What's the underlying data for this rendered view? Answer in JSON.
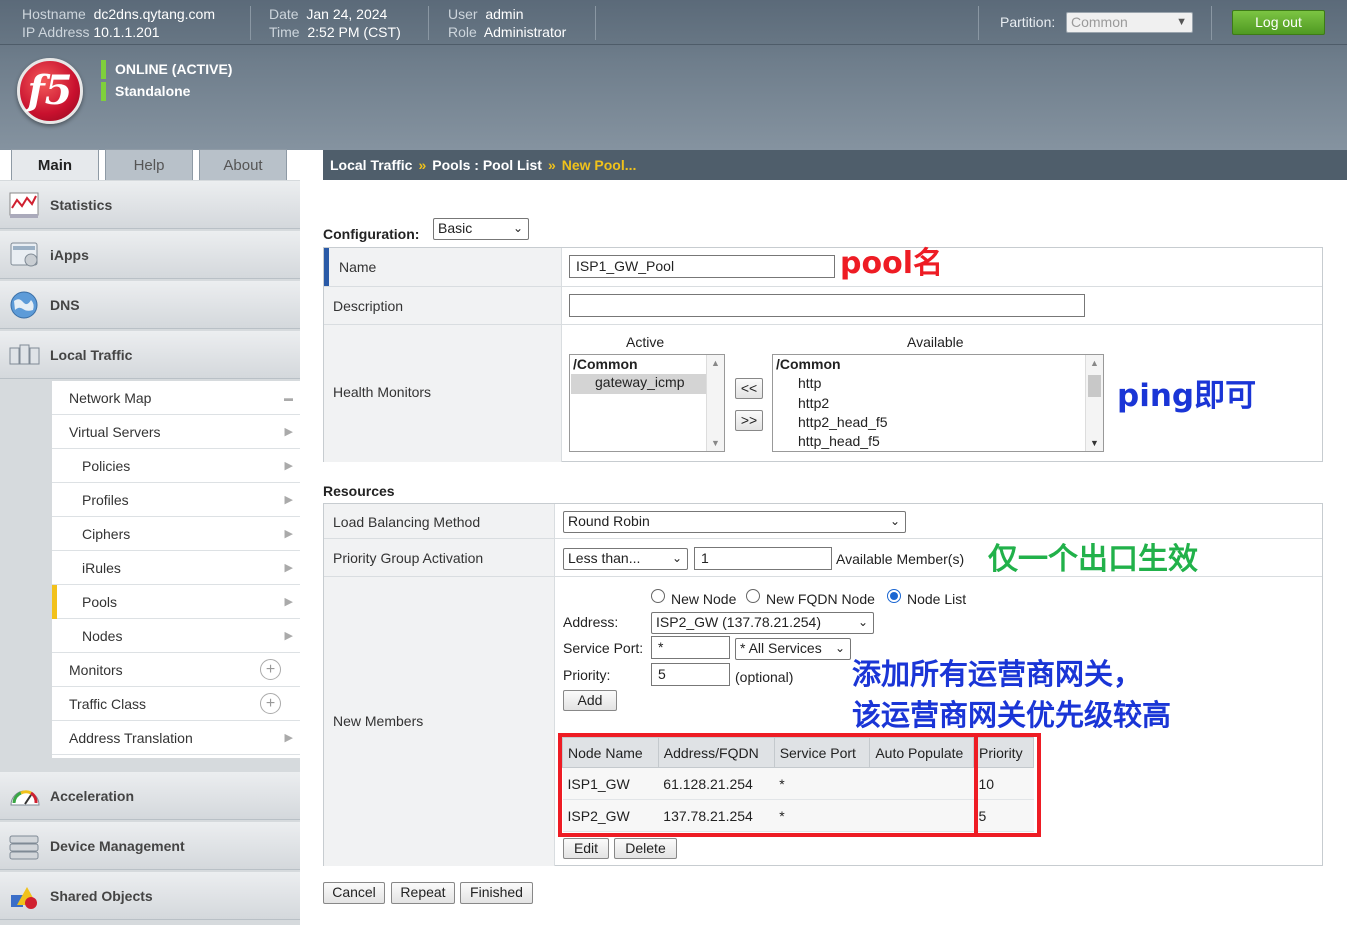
{
  "header": {
    "hostname_label": "Hostname",
    "hostname": "dc2dns.qytang.com",
    "ip_label": "IP Address",
    "ip": "10.1.1.201",
    "date_label": "Date",
    "date": "Jan 24, 2024",
    "time_label": "Time",
    "time": "2:52 PM (CST)",
    "user_label": "User",
    "user": "admin",
    "role_label": "Role",
    "role": "Administrator",
    "partition_label": "Partition:",
    "partition": "Common",
    "logout": "Log out",
    "status_online": "ONLINE (ACTIVE)",
    "status_mode": "Standalone",
    "logo_text": "f5"
  },
  "tabs": [
    "Main",
    "Help",
    "About"
  ],
  "breadcrumb": {
    "part1": "Local Traffic",
    "sep1": "»",
    "part2": "Pools : Pool List",
    "sep2": "»",
    "current": "New Pool..."
  },
  "sidebar": {
    "sections": [
      "Statistics",
      "iApps",
      "DNS",
      "Local Traffic",
      "Acceleration",
      "Device Management",
      "Shared Objects"
    ],
    "local_traffic_items": [
      "Network Map",
      "Virtual Servers",
      "Policies",
      "Profiles",
      "Ciphers",
      "iRules",
      "Pools",
      "Nodes",
      "Monitors",
      "Traffic Class",
      "Address Translation"
    ]
  },
  "configuration": {
    "label": "Configuration:",
    "mode": "Basic",
    "name_label": "Name",
    "name_value": "ISP1_GW_Pool",
    "description_label": "Description",
    "description_value": "",
    "health_label": "Health Monitors",
    "active_label": "Active",
    "available_label": "Available",
    "active_items": [
      "/Common",
      "gateway_icmp"
    ],
    "available_items": [
      "/Common",
      "http",
      "http2",
      "http2_head_f5",
      "http_head_f5"
    ],
    "move_left": "<<",
    "move_right": ">>"
  },
  "resources": {
    "label": "Resources",
    "lb_label": "Load Balancing Method",
    "lb_value": "Round Robin",
    "pga_label": "Priority Group Activation",
    "pga_value": "Less than...",
    "pga_count": "1",
    "pga_suffix": "Available Member(s)",
    "new_members_label": "New Members",
    "radio_new_node": "New Node",
    "radio_new_fqdn": "New FQDN Node",
    "radio_node_list": "Node List",
    "address_label": "Address:",
    "address_value": "ISP2_GW (137.78.21.254)",
    "service_port_label": "Service Port:",
    "service_port_value": "*",
    "service_select": "* All Services",
    "priority_label": "Priority:",
    "priority_value": "5",
    "optional": "(optional)",
    "add": "Add",
    "columns": [
      "Node Name",
      "Address/FQDN",
      "Service Port",
      "Auto Populate",
      "Priority"
    ],
    "rows": [
      {
        "node": "ISP1_GW",
        "address": "61.128.21.254",
        "port": "*",
        "auto": "",
        "priority": "10"
      },
      {
        "node": "ISP2_GW",
        "address": "137.78.21.254",
        "port": "*",
        "auto": "",
        "priority": "5"
      }
    ],
    "edit": "Edit",
    "delete": "Delete"
  },
  "footer_buttons": {
    "cancel": "Cancel",
    "repeat": "Repeat",
    "finished": "Finished"
  },
  "annotations": {
    "pool_name": "pool名",
    "ping": "ping即可",
    "single_exit": "仅一个出口生效",
    "add_gateways_1": "添加所有运营商网关，",
    "add_gateways_2": "该运营商网关优先级较高"
  },
  "colors": {
    "annot_red": "#ee1c24",
    "annot_blue": "#1a35d6",
    "annot_green": "#21b14a",
    "accent_yellow": "#f0c21b",
    "status_green": "#7fd03c"
  }
}
